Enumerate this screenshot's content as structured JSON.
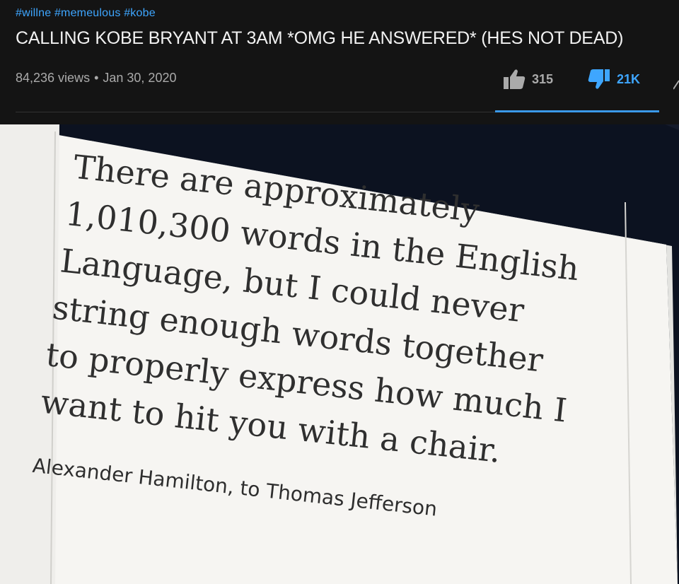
{
  "video": {
    "hashtags": "#willne #memeulous #kobe",
    "title": "CALLING KOBE BRYANT AT 3AM *OMG HE ANSWERED* (HES NOT DEAD)",
    "views": "84,236 views",
    "date": "Jan 30, 2020",
    "separator": "•",
    "likes": "315",
    "dislikes": "21K",
    "colors": {
      "background": "#141414",
      "accent": "#3ea6ff",
      "text": "#f1f1f1",
      "muted": "#aaaaaa"
    },
    "icons": {
      "like": "thumbs-up-icon",
      "dislike": "thumbs-down-icon",
      "share": "share-icon"
    }
  },
  "quote": {
    "lines": [
      "There are approximately",
      "1,010,300 words in the English",
      "Language, but I could never",
      "string enough words together",
      "to properly express how much I",
      "want to hit you with a chair."
    ],
    "attribution": "Alexander Hamilton, to Thomas Jefferson"
  }
}
